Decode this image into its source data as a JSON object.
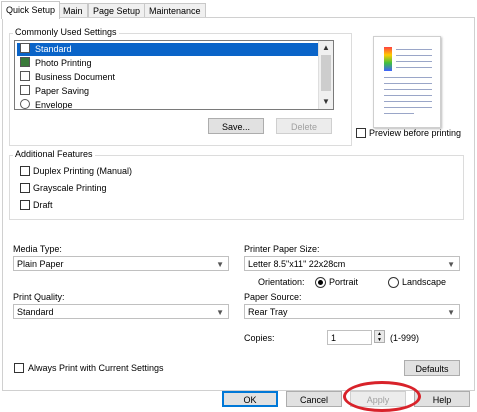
{
  "tabs": [
    "Quick Setup",
    "Main",
    "Page Setup",
    "Maintenance"
  ],
  "common": {
    "group_label": "Commonly Used Settings",
    "items": [
      "Standard",
      "Photo Printing",
      "Business Document",
      "Paper Saving",
      "Envelope"
    ],
    "selected_index": 0,
    "save_label": "Save...",
    "delete_label": "Delete"
  },
  "preview": {
    "label": "Preview before printing",
    "checked": false
  },
  "features": {
    "group_label": "Additional Features",
    "items": [
      "Duplex Printing (Manual)",
      "Grayscale Printing",
      "Draft"
    ]
  },
  "media_type": {
    "label": "Media Type:",
    "value": "Plain Paper"
  },
  "paper_size": {
    "label": "Printer Paper Size:",
    "value": "Letter 8.5\"x11\" 22x28cm"
  },
  "orientation": {
    "label": "Orientation:",
    "options": [
      "Portrait",
      "Landscape"
    ],
    "selected": "Portrait"
  },
  "print_quality": {
    "label": "Print Quality:",
    "value": "Standard"
  },
  "paper_source": {
    "label": "Paper Source:",
    "value": "Rear Tray"
  },
  "copies": {
    "label": "Copies:",
    "value": "1",
    "range": "(1-999)"
  },
  "always_print": {
    "label": "Always Print with Current Settings",
    "checked": false
  },
  "defaults_label": "Defaults",
  "buttons": {
    "ok": "OK",
    "cancel": "Cancel",
    "apply": "Apply",
    "help": "Help"
  },
  "colors": {
    "selection": "#0a64c8",
    "annotation": "#d8222a"
  }
}
